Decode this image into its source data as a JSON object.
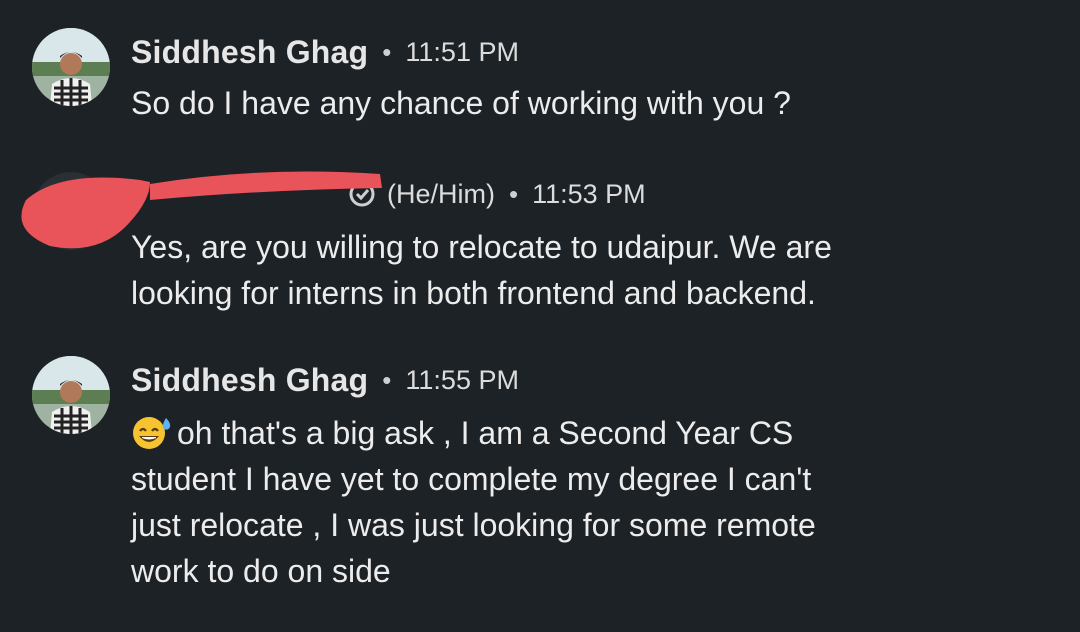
{
  "messages": [
    {
      "sender": "Siddhesh Ghag",
      "separator": "•",
      "time": "11:51 PM",
      "text": "So do I have any chance of working with you ?"
    },
    {
      "pronouns": "(He/Him)",
      "separator": "•",
      "time": "11:53 PM",
      "lines": [
        "Yes, are you willing to relocate to udaipur. We are",
        "looking for interns in both frontend and backend."
      ]
    },
    {
      "sender": "Siddhesh Ghag",
      "separator": "•",
      "time": "11:55 PM",
      "lines": [
        "oh that's a big ask , I am a Second Year CS",
        "student I have yet to complete my degree I can't",
        "just relocate , I was just looking for some remote",
        "work to do on side"
      ]
    }
  ],
  "icons": {
    "avatar": "person-photo",
    "verified": "verified-shield-icon",
    "emoji": "sweat-smile-emoji"
  },
  "colors": {
    "background": "#1d2226",
    "text": "#ececec",
    "redaction": "#e9535a"
  }
}
